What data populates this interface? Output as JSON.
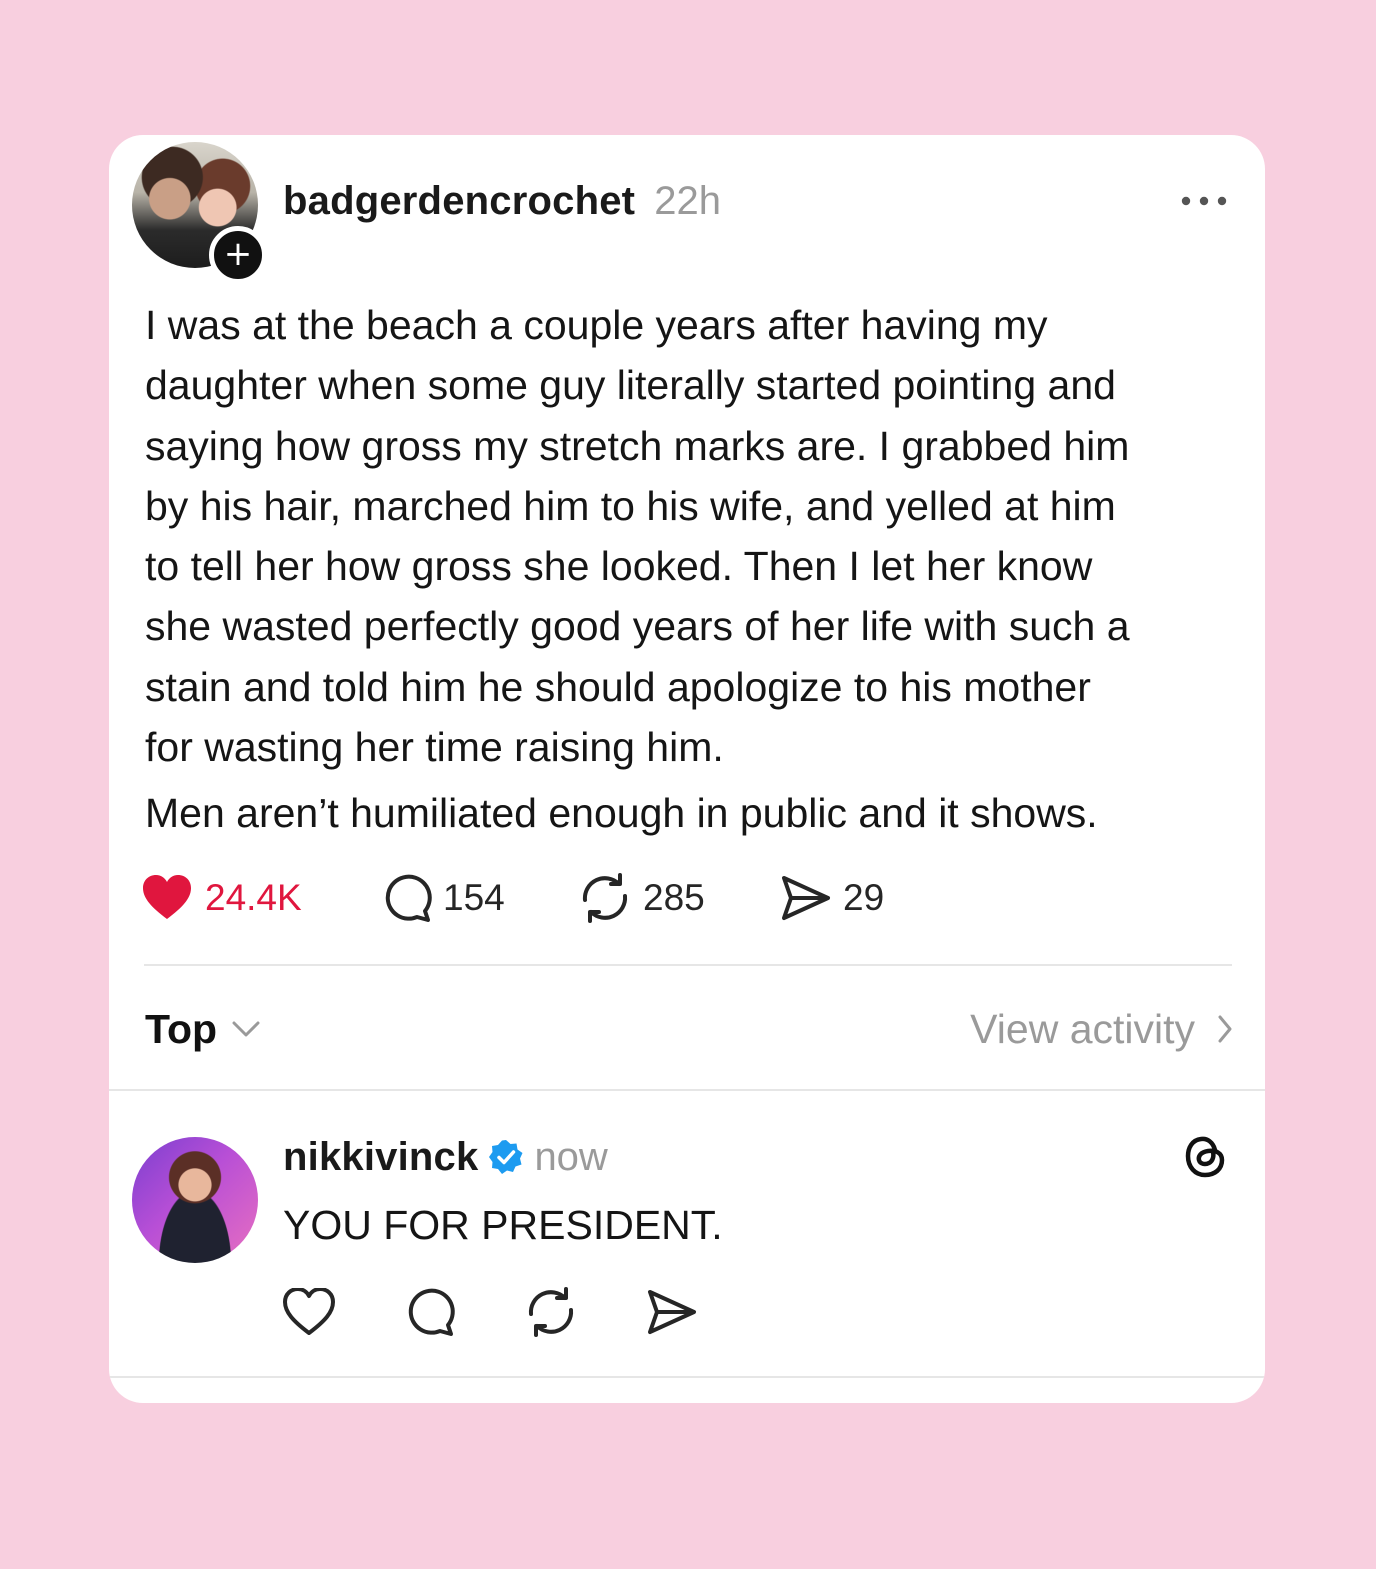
{
  "post": {
    "username": "badgerdencrochet",
    "timestamp": "22h",
    "paragraph1_lines": [
      "I was at the beach a couple years after having my",
      "daughter when some guy literally started pointing and",
      "saying how gross my stretch marks are. I grabbed him",
      "by his hair, marched him to his wife, and yelled at him",
      "to tell her how gross she looked. Then I let her know",
      "she wasted perfectly good years of her life with such a",
      "stain and told him he should apologize to his mother",
      "for wasting her time raising him."
    ],
    "paragraph2": "Men aren’t humiliated enough in public and it shows.",
    "likes": "24.4K",
    "comments": "154",
    "reposts": "285",
    "shares": "29",
    "liked": true
  },
  "replies_bar": {
    "sort_label": "Top",
    "activity_label": "View activity"
  },
  "reply": {
    "username": "nikkivinck",
    "verified": true,
    "timestamp": "now",
    "text": "YOU FOR PRESIDENT."
  },
  "icons": {
    "more": "more-horizontal-icon",
    "follow": "plus-icon",
    "like": "heart-icon",
    "comment": "comment-bubble-icon",
    "repost": "repost-icon",
    "share": "send-icon",
    "sort_chevron": "chevron-down-icon",
    "activity_chevron": "chevron-right-icon",
    "verified": "verified-badge-icon",
    "app": "threads-logo-icon"
  },
  "colors": {
    "background": "#f8cfdf",
    "card": "#ffffff",
    "like_red": "#e0163e",
    "verified_blue": "#1d9bf0",
    "muted_text": "#9a9a9a"
  }
}
